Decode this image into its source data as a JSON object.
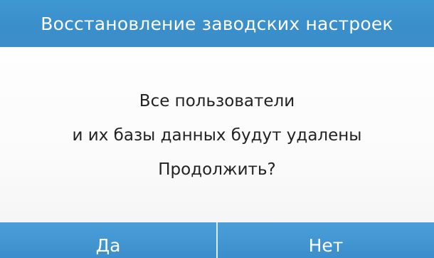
{
  "dialog": {
    "title": "Восстановление заводских настроек",
    "message_lines": [
      "Все пользователи",
      "и их базы данных будут удалены",
      "Продолжить?"
    ],
    "buttons": {
      "yes_label": "Да",
      "no_label": "Нет"
    }
  },
  "colors": {
    "accent": "#3b8fcb",
    "background": "#ffffff",
    "text": "#222222"
  }
}
